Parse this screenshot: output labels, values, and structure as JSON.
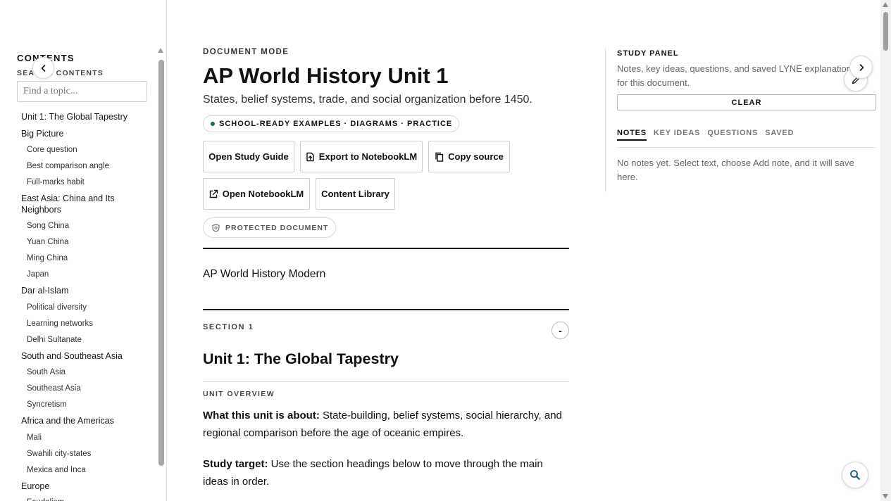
{
  "sidebar": {
    "title": "CONTENTS",
    "search_label": "SEARCH CONTENTS",
    "search_placeholder": "Find a topic...",
    "toc": [
      {
        "label": "Unit 1: The Global Tapestry",
        "level": 1
      },
      {
        "label": "Big Picture",
        "level": 1
      },
      {
        "label": "Core question",
        "level": 2
      },
      {
        "label": "Best comparison angle",
        "level": 2
      },
      {
        "label": "Full-marks habit",
        "level": 2
      },
      {
        "label": "East Asia: China and Its Neighbors",
        "level": 1
      },
      {
        "label": "Song China",
        "level": 2
      },
      {
        "label": "Yuan China",
        "level": 2
      },
      {
        "label": "Ming China",
        "level": 2
      },
      {
        "label": "Japan",
        "level": 2
      },
      {
        "label": "Dar al-Islam",
        "level": 1
      },
      {
        "label": "Political diversity",
        "level": 2
      },
      {
        "label": "Learning networks",
        "level": 2
      },
      {
        "label": "Delhi Sultanate",
        "level": 2
      },
      {
        "label": "South and Southeast Asia",
        "level": 1
      },
      {
        "label": "South Asia",
        "level": 2
      },
      {
        "label": "Southeast Asia",
        "level": 2
      },
      {
        "label": "Syncretism",
        "level": 2
      },
      {
        "label": "Africa and the Americas",
        "level": 1
      },
      {
        "label": "Mali",
        "level": 2
      },
      {
        "label": "Swahili city-states",
        "level": 2
      },
      {
        "label": "Mexica and Inca",
        "level": 2
      },
      {
        "label": "Europe",
        "level": 1
      },
      {
        "label": "Feudalism",
        "level": 2
      }
    ]
  },
  "document": {
    "mode_label": "DOCUMENT MODE",
    "title": "AP World History Unit 1",
    "subtitle": "States, belief systems, trade, and social organization before 1450.",
    "pill": "SCHOOL-READY EXAMPLES · DIAGRAMS · PRACTICE",
    "buttons": {
      "study_guide": "Open Study Guide",
      "export": "Export to NotebookLM",
      "copy": "Copy source",
      "open_notebook": "Open NotebookLM",
      "library": "Content Library"
    },
    "protected_label": "PROTECTED DOCUMENT",
    "course_name": "AP World History Modern",
    "section_label": "SECTION 1",
    "section_toggle": "-",
    "section_title": "Unit 1: The Global Tapestry",
    "overview_label": "UNIT OVERVIEW",
    "p1_lead": "What this unit is about:",
    "p1_text": " State-building, belief systems, social hierarchy, and regional comparison before the age of oceanic empires.",
    "p2_lead": "Study target:",
    "p2_text": " Use the section headings below to move through the main ideas in order."
  },
  "panel": {
    "title": "STUDY PANEL",
    "description": "Notes, key ideas, questions, and saved LYNE explanations for this document.",
    "clear_label": "CLEAR",
    "tabs": [
      "NOTES",
      "KEY IDEAS",
      "QUESTIONS",
      "SAVED"
    ],
    "active_tab": "NOTES",
    "empty_text": "No notes yet. Select text, choose Add note, and it will save here."
  },
  "icons": {
    "collapse_left": "chevron-left-icon",
    "expand_right": "chevron-right-icon",
    "edit": "pencil-icon",
    "search": "search-icon",
    "export": "file-export-icon",
    "copy": "copy-icon",
    "external": "external-link-icon",
    "shield": "shield-icon"
  },
  "colors": {
    "accent_green": "#1f6b3a",
    "text": "#111111",
    "muted": "#666666"
  }
}
